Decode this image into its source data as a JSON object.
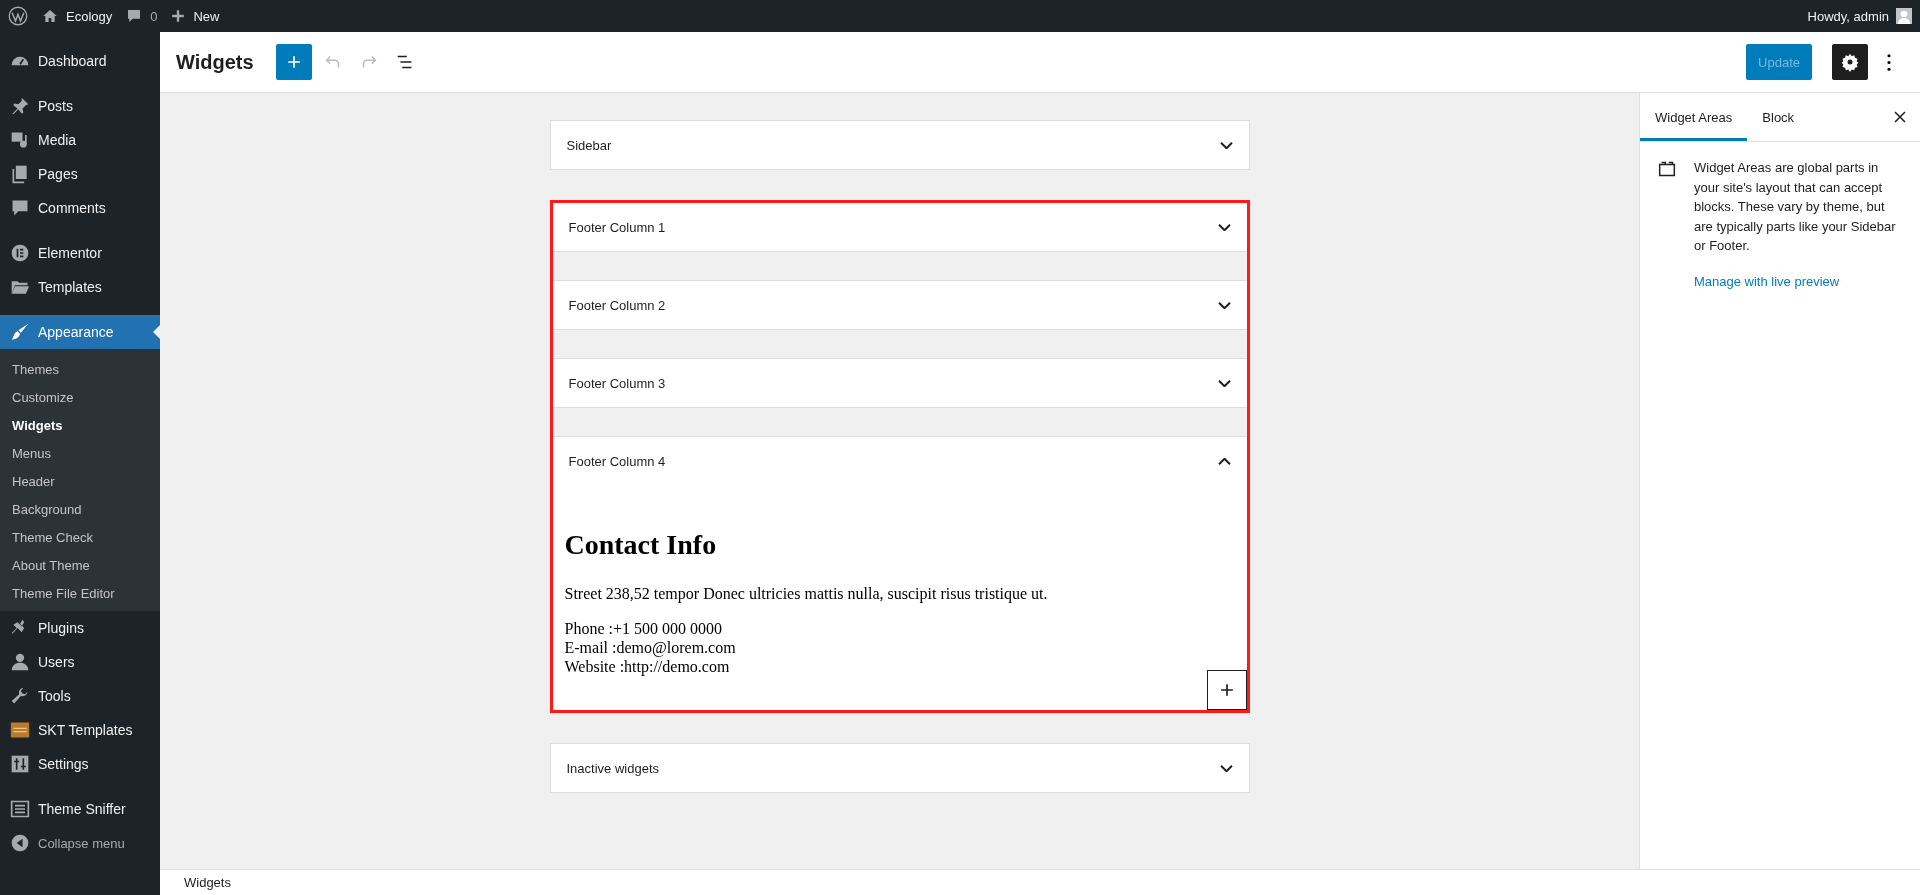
{
  "admin_bar": {
    "site": "Ecology",
    "comments": "0",
    "new": "New",
    "greeting": "Howdy, admin"
  },
  "menu": [
    {
      "kind": "item",
      "label": "Dashboard",
      "selected": false
    },
    {
      "kind": "separator"
    },
    {
      "kind": "item",
      "label": "Posts",
      "selected": false
    },
    {
      "kind": "item",
      "label": "Media",
      "selected": false
    },
    {
      "kind": "item",
      "label": "Pages",
      "selected": false
    },
    {
      "kind": "item",
      "label": "Comments",
      "selected": false
    },
    {
      "kind": "separator"
    },
    {
      "kind": "item",
      "label": "Elementor",
      "selected": false
    },
    {
      "kind": "item",
      "label": "Templates",
      "selected": false
    },
    {
      "kind": "separator"
    },
    {
      "kind": "item",
      "label": "Appearance",
      "selected": true,
      "children": [
        {
          "label": "Themes",
          "selected": false
        },
        {
          "label": "Customize",
          "selected": false
        },
        {
          "label": "Widgets",
          "selected": true
        },
        {
          "label": "Menus",
          "selected": false
        },
        {
          "label": "Header",
          "selected": false
        },
        {
          "label": "Background",
          "selected": false
        },
        {
          "label": "Theme Check",
          "selected": false
        },
        {
          "label": "About Theme",
          "selected": false
        },
        {
          "label": "Theme File Editor",
          "selected": false
        }
      ]
    },
    {
      "kind": "item",
      "label": "Plugins",
      "selected": false
    },
    {
      "kind": "item",
      "label": "Users",
      "selected": false
    },
    {
      "kind": "item",
      "label": "Tools",
      "selected": false
    },
    {
      "kind": "item",
      "label": "SKT Templates",
      "selected": false
    },
    {
      "kind": "item",
      "label": "Settings",
      "selected": false
    },
    {
      "kind": "separator"
    },
    {
      "kind": "item",
      "label": "Theme Sniffer",
      "selected": false
    },
    {
      "kind": "collapse",
      "label": "Collapse menu",
      "selected": false
    }
  ],
  "header": {
    "title": "Widgets",
    "undo_disabled": true,
    "redo_disabled": true,
    "update": {
      "label": "Update",
      "disabled": true
    },
    "settings_selected": true
  },
  "widget_areas": [
    {
      "label": "Sidebar",
      "expanded": false,
      "highlighted": false
    },
    {
      "label": "Footer Column 1",
      "expanded": false,
      "highlighted": true
    },
    {
      "label": "Footer Column 2",
      "expanded": false,
      "highlighted": true
    },
    {
      "label": "Footer Column 3",
      "expanded": false,
      "highlighted": true
    },
    {
      "label": "Footer Column 4",
      "expanded": true,
      "highlighted": true,
      "content": {
        "heading": "Contact Info",
        "paragraph": "Street 238,52 tempor Donec ultricies mattis nulla, suscipit risus tristique ut.",
        "lines": [
          "Phone :+1 500 000 0000",
          "E-mail :demo@lorem.com",
          "Website :http://demo.com"
        ]
      }
    },
    {
      "label": "Inactive widgets",
      "expanded": false,
      "highlighted": false
    }
  ],
  "inspector": {
    "tabs": [
      {
        "label": "Widget Areas",
        "selected": true
      },
      {
        "label": "Block",
        "selected": false
      }
    ],
    "description": "Widget Areas are global parts in your site's layout that can accept blocks. These vary by theme, but are typically parts like your Sidebar or Footer.",
    "link": "Manage with live preview"
  },
  "footer": {
    "breadcrumb": "Widgets"
  }
}
